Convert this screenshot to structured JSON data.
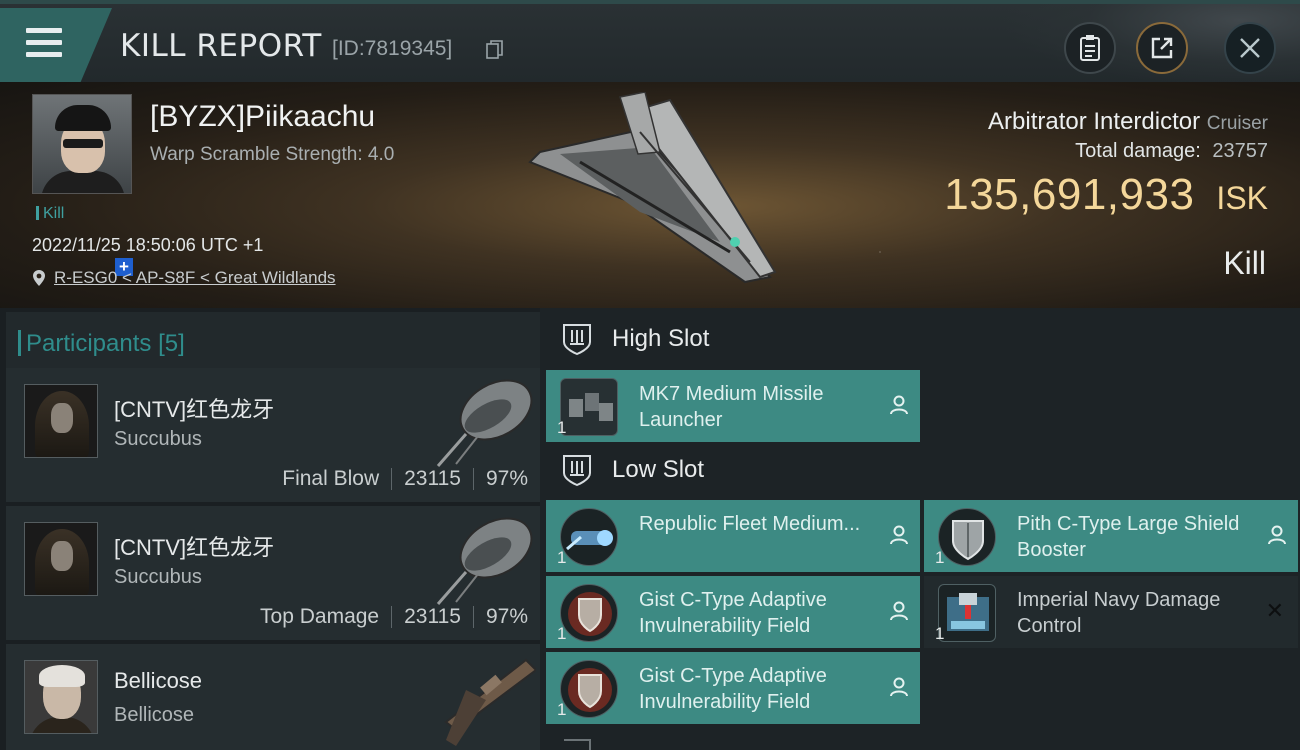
{
  "window": {
    "title": "KILL REPORT",
    "report_id": "[ID:7819345]",
    "icons": [
      "menu-icon",
      "copy-icon",
      "clipboard-icon",
      "share-icon",
      "close-icon"
    ]
  },
  "victim": {
    "name": "[BYZX]Piikaachu",
    "scramble": "Warp Scramble Strength: 4.0",
    "kill_tag": "Kill",
    "datetime": "2022/11/25 18:50:06 UTC +1",
    "location": "R-ESG0 < AP-S8F < Great Wildlands",
    "ship_name": "Arbitrator Interdictor",
    "ship_class": "Cruiser",
    "total_damage_label": "Total damage:",
    "total_damage": "23757",
    "isk_value": "135,691,933",
    "isk_unit": "ISK",
    "result": "Kill"
  },
  "participants": {
    "label": "Participants",
    "count": "[5]",
    "items": [
      {
        "name": "[CNTV]红色龙牙",
        "ship": "Succubus",
        "role": "Final Blow",
        "damage": "23115",
        "percent": "97%"
      },
      {
        "name": "[CNTV]红色龙牙",
        "ship": "Succubus",
        "role": "Top Damage",
        "damage": "23115",
        "percent": "97%"
      },
      {
        "name": "Bellicose",
        "ship": "Bellicose"
      }
    ]
  },
  "slots": {
    "high": {
      "label": "High Slot",
      "modules": [
        {
          "name": "MK7 Medium Missile Launcher",
          "qty": "1"
        }
      ]
    },
    "low": {
      "label": "Low Slot",
      "modules": [
        {
          "name": "Republic Fleet Medium...",
          "qty": "1"
        },
        {
          "name": "Pith C-Type Large Shield Booster",
          "qty": "1"
        },
        {
          "name": "Gist C-Type Adaptive Invulnerability Field",
          "qty": "1"
        },
        {
          "name": "Imperial Navy Damage Control",
          "qty": "1"
        },
        {
          "name": "Gist C-Type Adaptive Invulnerability Field",
          "qty": "1"
        }
      ]
    }
  },
  "colors": {
    "accent_teal": "#3d8a83",
    "isk_gold": "#f4d79a",
    "participants_label": "#2f8d8c"
  }
}
